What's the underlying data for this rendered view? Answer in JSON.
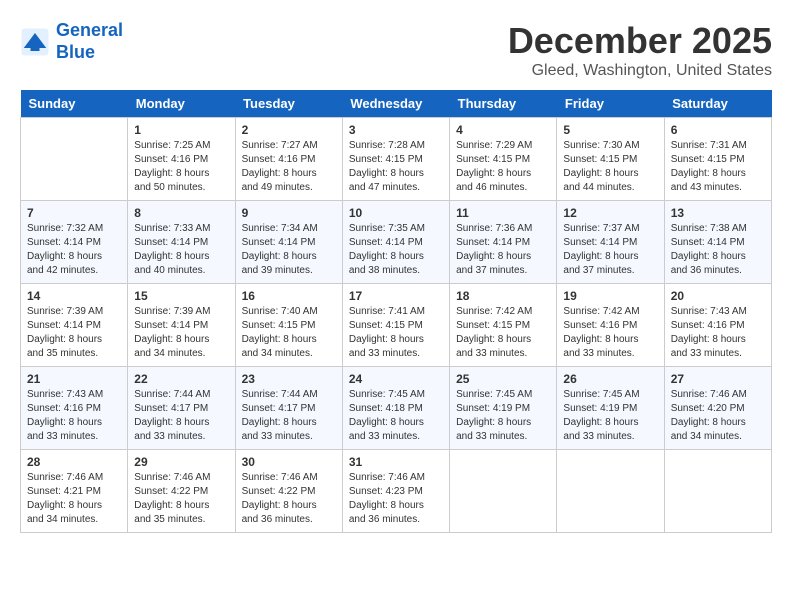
{
  "logo": {
    "line1": "General",
    "line2": "Blue"
  },
  "title": "December 2025",
  "location": "Gleed, Washington, United States",
  "days_of_week": [
    "Sunday",
    "Monday",
    "Tuesday",
    "Wednesday",
    "Thursday",
    "Friday",
    "Saturday"
  ],
  "weeks": [
    [
      {
        "day": "",
        "sunrise": "",
        "sunset": "",
        "daylight": ""
      },
      {
        "day": "1",
        "sunrise": "Sunrise: 7:25 AM",
        "sunset": "Sunset: 4:16 PM",
        "daylight": "Daylight: 8 hours and 50 minutes."
      },
      {
        "day": "2",
        "sunrise": "Sunrise: 7:27 AM",
        "sunset": "Sunset: 4:16 PM",
        "daylight": "Daylight: 8 hours and 49 minutes."
      },
      {
        "day": "3",
        "sunrise": "Sunrise: 7:28 AM",
        "sunset": "Sunset: 4:15 PM",
        "daylight": "Daylight: 8 hours and 47 minutes."
      },
      {
        "day": "4",
        "sunrise": "Sunrise: 7:29 AM",
        "sunset": "Sunset: 4:15 PM",
        "daylight": "Daylight: 8 hours and 46 minutes."
      },
      {
        "day": "5",
        "sunrise": "Sunrise: 7:30 AM",
        "sunset": "Sunset: 4:15 PM",
        "daylight": "Daylight: 8 hours and 44 minutes."
      },
      {
        "day": "6",
        "sunrise": "Sunrise: 7:31 AM",
        "sunset": "Sunset: 4:15 PM",
        "daylight": "Daylight: 8 hours and 43 minutes."
      }
    ],
    [
      {
        "day": "7",
        "sunrise": "Sunrise: 7:32 AM",
        "sunset": "Sunset: 4:14 PM",
        "daylight": "Daylight: 8 hours and 42 minutes."
      },
      {
        "day": "8",
        "sunrise": "Sunrise: 7:33 AM",
        "sunset": "Sunset: 4:14 PM",
        "daylight": "Daylight: 8 hours and 40 minutes."
      },
      {
        "day": "9",
        "sunrise": "Sunrise: 7:34 AM",
        "sunset": "Sunset: 4:14 PM",
        "daylight": "Daylight: 8 hours and 39 minutes."
      },
      {
        "day": "10",
        "sunrise": "Sunrise: 7:35 AM",
        "sunset": "Sunset: 4:14 PM",
        "daylight": "Daylight: 8 hours and 38 minutes."
      },
      {
        "day": "11",
        "sunrise": "Sunrise: 7:36 AM",
        "sunset": "Sunset: 4:14 PM",
        "daylight": "Daylight: 8 hours and 37 minutes."
      },
      {
        "day": "12",
        "sunrise": "Sunrise: 7:37 AM",
        "sunset": "Sunset: 4:14 PM",
        "daylight": "Daylight: 8 hours and 37 minutes."
      },
      {
        "day": "13",
        "sunrise": "Sunrise: 7:38 AM",
        "sunset": "Sunset: 4:14 PM",
        "daylight": "Daylight: 8 hours and 36 minutes."
      }
    ],
    [
      {
        "day": "14",
        "sunrise": "Sunrise: 7:39 AM",
        "sunset": "Sunset: 4:14 PM",
        "daylight": "Daylight: 8 hours and 35 minutes."
      },
      {
        "day": "15",
        "sunrise": "Sunrise: 7:39 AM",
        "sunset": "Sunset: 4:14 PM",
        "daylight": "Daylight: 8 hours and 34 minutes."
      },
      {
        "day": "16",
        "sunrise": "Sunrise: 7:40 AM",
        "sunset": "Sunset: 4:15 PM",
        "daylight": "Daylight: 8 hours and 34 minutes."
      },
      {
        "day": "17",
        "sunrise": "Sunrise: 7:41 AM",
        "sunset": "Sunset: 4:15 PM",
        "daylight": "Daylight: 8 hours and 33 minutes."
      },
      {
        "day": "18",
        "sunrise": "Sunrise: 7:42 AM",
        "sunset": "Sunset: 4:15 PM",
        "daylight": "Daylight: 8 hours and 33 minutes."
      },
      {
        "day": "19",
        "sunrise": "Sunrise: 7:42 AM",
        "sunset": "Sunset: 4:16 PM",
        "daylight": "Daylight: 8 hours and 33 minutes."
      },
      {
        "day": "20",
        "sunrise": "Sunrise: 7:43 AM",
        "sunset": "Sunset: 4:16 PM",
        "daylight": "Daylight: 8 hours and 33 minutes."
      }
    ],
    [
      {
        "day": "21",
        "sunrise": "Sunrise: 7:43 AM",
        "sunset": "Sunset: 4:16 PM",
        "daylight": "Daylight: 8 hours and 33 minutes."
      },
      {
        "day": "22",
        "sunrise": "Sunrise: 7:44 AM",
        "sunset": "Sunset: 4:17 PM",
        "daylight": "Daylight: 8 hours and 33 minutes."
      },
      {
        "day": "23",
        "sunrise": "Sunrise: 7:44 AM",
        "sunset": "Sunset: 4:17 PM",
        "daylight": "Daylight: 8 hours and 33 minutes."
      },
      {
        "day": "24",
        "sunrise": "Sunrise: 7:45 AM",
        "sunset": "Sunset: 4:18 PM",
        "daylight": "Daylight: 8 hours and 33 minutes."
      },
      {
        "day": "25",
        "sunrise": "Sunrise: 7:45 AM",
        "sunset": "Sunset: 4:19 PM",
        "daylight": "Daylight: 8 hours and 33 minutes."
      },
      {
        "day": "26",
        "sunrise": "Sunrise: 7:45 AM",
        "sunset": "Sunset: 4:19 PM",
        "daylight": "Daylight: 8 hours and 33 minutes."
      },
      {
        "day": "27",
        "sunrise": "Sunrise: 7:46 AM",
        "sunset": "Sunset: 4:20 PM",
        "daylight": "Daylight: 8 hours and 34 minutes."
      }
    ],
    [
      {
        "day": "28",
        "sunrise": "Sunrise: 7:46 AM",
        "sunset": "Sunset: 4:21 PM",
        "daylight": "Daylight: 8 hours and 34 minutes."
      },
      {
        "day": "29",
        "sunrise": "Sunrise: 7:46 AM",
        "sunset": "Sunset: 4:22 PM",
        "daylight": "Daylight: 8 hours and 35 minutes."
      },
      {
        "day": "30",
        "sunrise": "Sunrise: 7:46 AM",
        "sunset": "Sunset: 4:22 PM",
        "daylight": "Daylight: 8 hours and 36 minutes."
      },
      {
        "day": "31",
        "sunrise": "Sunrise: 7:46 AM",
        "sunset": "Sunset: 4:23 PM",
        "daylight": "Daylight: 8 hours and 36 minutes."
      },
      {
        "day": "",
        "sunrise": "",
        "sunset": "",
        "daylight": ""
      },
      {
        "day": "",
        "sunrise": "",
        "sunset": "",
        "daylight": ""
      },
      {
        "day": "",
        "sunrise": "",
        "sunset": "",
        "daylight": ""
      }
    ]
  ]
}
